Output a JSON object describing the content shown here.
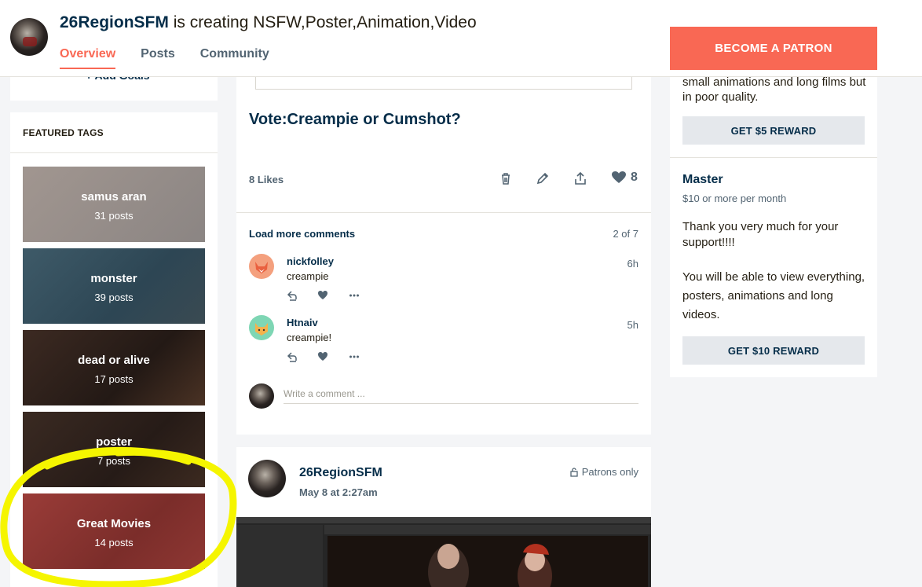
{
  "header": {
    "creator_name": "26RegionSFM",
    "creating_text": " is creating NSFW,Poster,Animation,Video",
    "tabs": [
      {
        "label": "Overview"
      },
      {
        "label": "Posts"
      },
      {
        "label": "Community"
      }
    ],
    "become_patron_label": "BECOME A PATRON"
  },
  "left": {
    "add_goals_label": "Add Goals",
    "featured_tags_title": "FEATURED TAGS",
    "tags": [
      {
        "name": "samus aran",
        "count": "31 posts"
      },
      {
        "name": "monster",
        "count": "39 posts"
      },
      {
        "name": "dead or alive",
        "count": "17 posts"
      },
      {
        "name": "poster",
        "count": "7 posts"
      },
      {
        "name": "Great Movies",
        "count": "14 posts"
      }
    ]
  },
  "post": {
    "title": "Vote:Creampie or Cumshot?",
    "likes_label": "8 Likes",
    "like_count": "8",
    "load_more_label": "Load more comments",
    "comment_pager": "2 of 7",
    "comments": [
      {
        "author": "nickfolley",
        "text": "creampie",
        "time": "6h"
      },
      {
        "author": "Htnaiv",
        "text": "creampie!",
        "time": "5h"
      }
    ],
    "comment_placeholder": "Write a comment ..."
  },
  "next_post": {
    "author": "26RegionSFM",
    "date": "May 8 at 2:27am",
    "visibility": "Patrons only"
  },
  "tiers": {
    "prev_tier_desc": "small animations and long films but in poor quality.",
    "prev_reward_label": "GET $5 REWARD",
    "tier_name": "Master",
    "tier_price": "$10 or more per month",
    "tier_desc_1": "Thank you very much for your support!!!!",
    "tier_desc_2": "You will be able to view everything, posters, animations and long videos.",
    "reward_label": "GET $10 REWARD"
  },
  "colors": {
    "accent": "#f96854",
    "navy": "#052d49",
    "annotation": "#f5f500"
  }
}
